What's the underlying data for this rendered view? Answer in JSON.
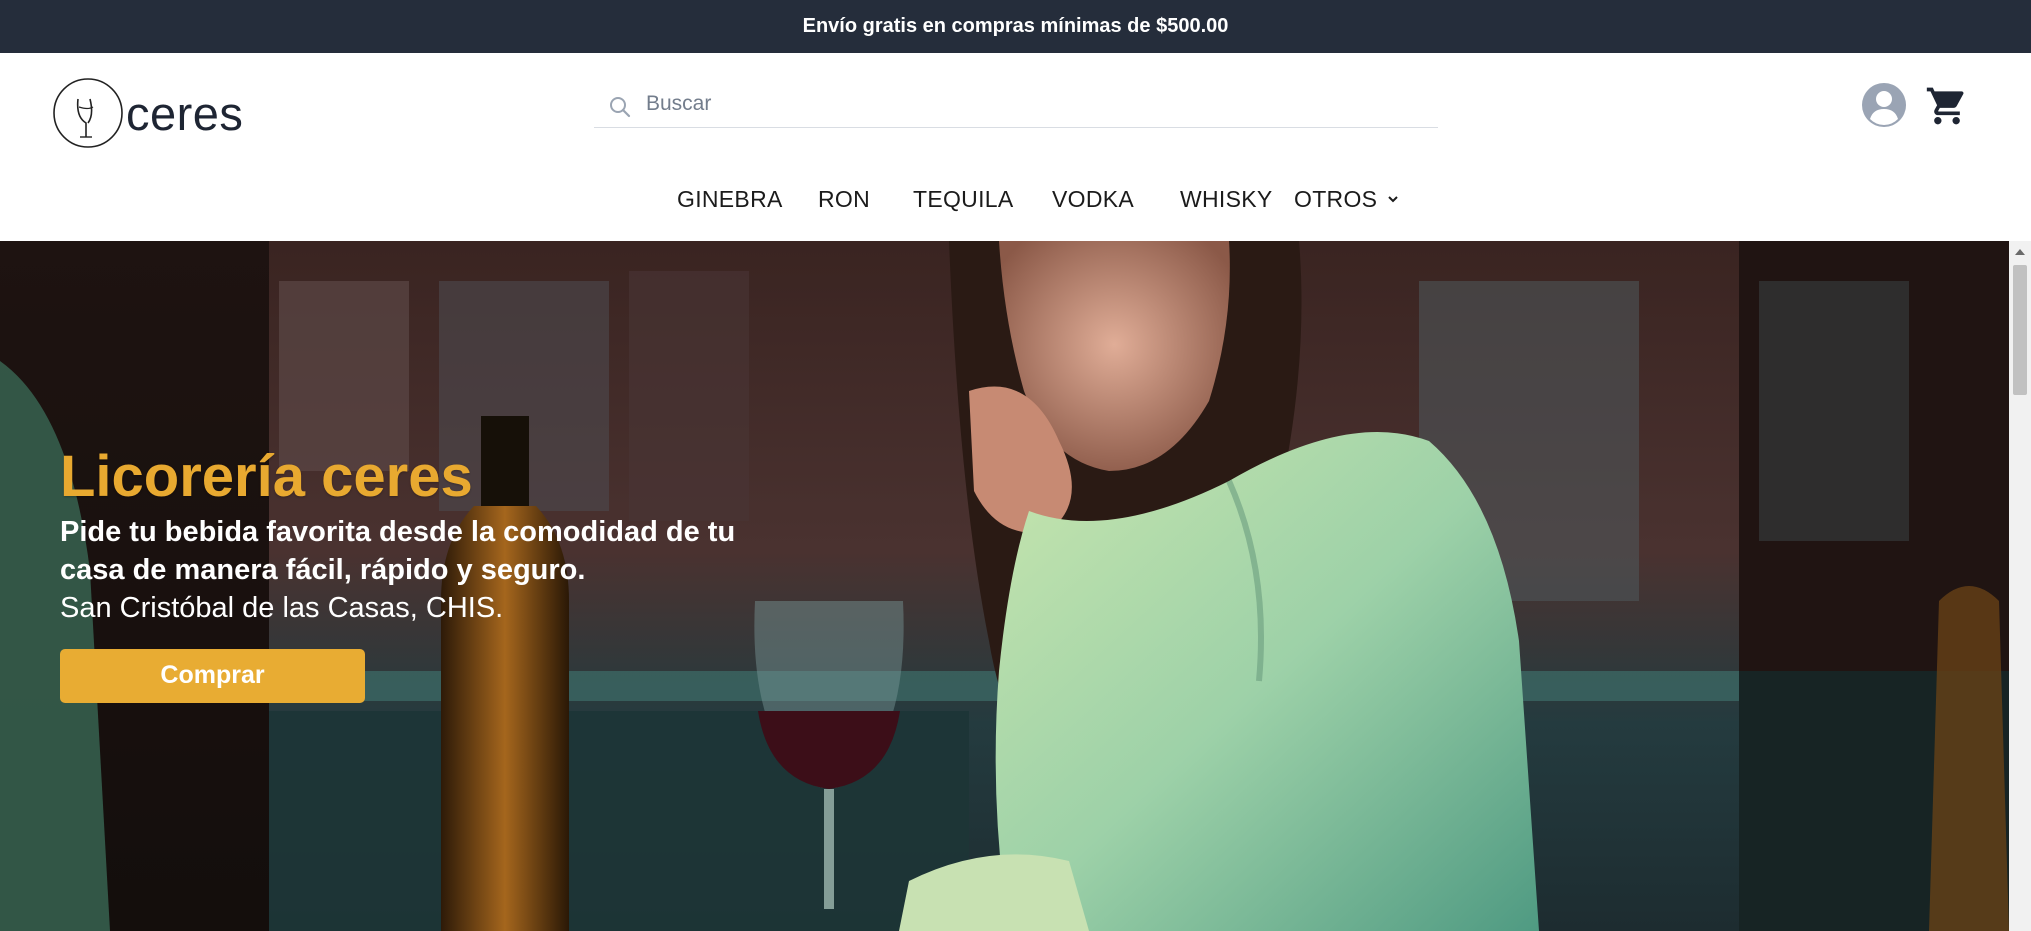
{
  "announcement": "Envío gratis en compras mínimas de $500.00",
  "brand": {
    "name": "ceres"
  },
  "search": {
    "placeholder": "Buscar"
  },
  "header_icons": [
    "user-icon",
    "cart-icon"
  ],
  "nav": {
    "items": [
      "GINEBRA",
      "RON",
      "TEQUILA",
      "VODKA",
      "WHISKY",
      "OTROS"
    ]
  },
  "hero": {
    "title": "Licorería ceres",
    "subtitle_line1": "Pide tu bebida favorita desde la comodidad de tu",
    "subtitle_line2": "casa de manera fácil, rápido y seguro.",
    "location": "San Cristóbal de las Casas, CHIS.",
    "cta_label": "Comprar"
  },
  "colors": {
    "topbar": "#252d3b",
    "accent": "#e8ac33",
    "text_dark": "#1e2533"
  }
}
